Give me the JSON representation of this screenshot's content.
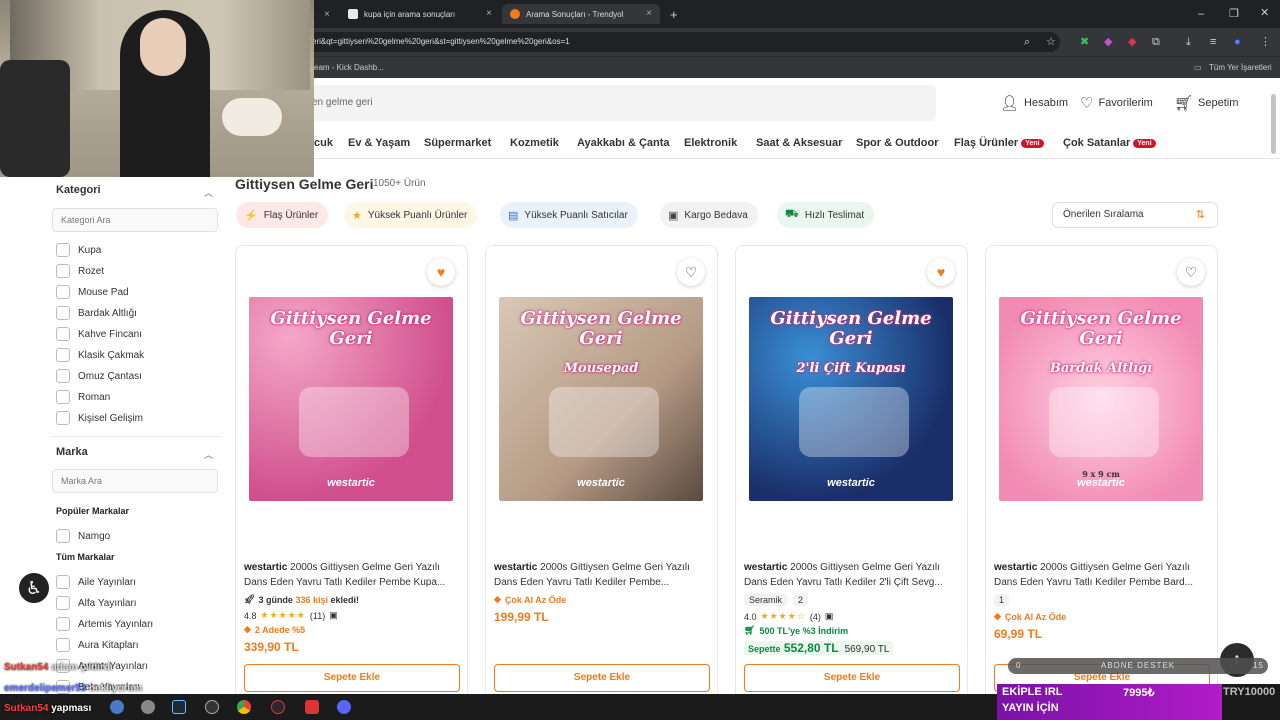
{
  "browser": {
    "tabs": [
      {
        "title": "kupa için arama sonuçları",
        "icon": "kick-icon"
      },
      {
        "title": "Arama Sonuçları - Trendyol",
        "icon": "trendyol-icon"
      }
    ],
    "new_tab": "+",
    "url": "eri&qt=gittiysen%20gelme%20geri&st=gittiysen%20gelme%20geri&os=1",
    "bookmarks": [
      "eam - Kick Dashb...",
      "Tüm Yer İşaretleri"
    ]
  },
  "header": {
    "search_value": "en gelme geri",
    "account": "Hesabım",
    "favorites": "Favorilerim",
    "cart": "Sepetim"
  },
  "nav": {
    "items": [
      "cuk",
      "Ev & Yaşam",
      "Süpermarket",
      "Kozmetik",
      "Ayakkabı & Çanta",
      "Elektronik",
      "Saat & Aksesuar",
      "Spor & Outdoor",
      "Flaş Ürünler",
      "Çok Satanlar"
    ],
    "badge": "Yeni"
  },
  "sidebar": {
    "category_title": "Kategori",
    "category_search": "Kategori Ara",
    "categories": [
      "Kupa",
      "Rozet",
      "Mouse Pad",
      "Bardak Altlığı",
      "Kahve Fincanı",
      "Klasik Çakmak",
      "Omuz Çantası",
      "Roman",
      "Kişisel Gelişim"
    ],
    "brand_title": "Marka",
    "brand_search": "Marka Ara",
    "popular_brands_title": "Popüler Markalar",
    "popular_brands": [
      "Namgo"
    ],
    "all_brands_title": "Tüm Markalar",
    "all_brands": [
      "Aile Yayınları",
      "Alfa Yayınları",
      "Artemis Yayınları",
      "Aura Kitapları",
      "Ayrıntı Yayınları",
      "Beta Yayınları"
    ]
  },
  "results": {
    "title": "Gittiysen Gelme Geri",
    "count": "1050+ Ürün",
    "chips": [
      "Flaş Ürünler",
      "Yüksek Puanlı Ürünler",
      "Yüksek Puanlı Satıcılar",
      "Kargo Bedava",
      "Hızlı Teslimat"
    ],
    "sort": "Önerilen Sıralama"
  },
  "products": [
    {
      "brand": "westartic",
      "name": "2000s Gittiysen Gelme Geri Yazılı Dans Eden Yavru Tatlı Kediler Pembe Kupa...",
      "image_text": "Gittiysen Gelme Geri",
      "image_sub": "",
      "badge_icon": "rocket-icon",
      "badge_pre": "3 günde",
      "badge_num": "336 kişi",
      "badge_post": "ekledi!",
      "rating": "4.8",
      "stars": 4.8,
      "reviews": "(11)",
      "promo": "2 Adede %5",
      "price": "339,90 TL",
      "add": "Sepete Ekle",
      "favorited": true
    },
    {
      "brand": "westartic",
      "name": "2000s Gittiysen Gelme Geri Yazılı Dans Eden Yavru Tatlı Kediler Pembe...",
      "image_text": "Gittiysen Gelme Geri",
      "image_sub": "Mousepad",
      "promo": "Çok Al Az Öde",
      "price": "199,99 TL",
      "add": "Sepete Ekle",
      "favorited": false
    },
    {
      "brand": "westartic",
      "name": "2000s Gittiysen Gelme Geri Yazılı Dans Eden Yavru Tatlı Kediler 2'li Çift Sevg...",
      "image_text": "Gittiysen Gelme Geri",
      "image_sub": "2'li Çift Kupası",
      "tags": [
        "Seramik",
        "2"
      ],
      "rating": "4.0",
      "stars": 4.0,
      "reviews": "(4)",
      "discount": "500 TL'ye %3 İndirim",
      "basket_label": "Sepette",
      "basket_price": "552,80 TL",
      "old_price": "569,90 TL",
      "add": "Sepete Ekle",
      "favorited": true
    },
    {
      "brand": "westartic",
      "name": "2000s Gittiysen Gelme Geri Yazılı Dans Eden Yavru Tatlı Kediler Pembe Bard...",
      "image_text": "Gittiysen Gelme Geri",
      "image_sub": "Bardak Altlığı",
      "image_size": "9 x 9 cm",
      "tags": [
        "1"
      ],
      "promo": "Çok Al Az Öde",
      "price": "69,99 TL",
      "add": "Sepete Ekle",
      "favorited": false
    }
  ],
  "image_brand_mark": "westartic",
  "overlay": {
    "chat": [
      {
        "user": "Sutkan54",
        "msg": "adam çıldırdı",
        "color": "#ff3b3b"
      },
      {
        "user": "emerdelipemer53",
        "msg": "bekliyorum",
        "color": "#5b7cff"
      },
      {
        "user": "Sutkan54",
        "msg": "yapması",
        "color": "#ff3b3b"
      }
    ],
    "sub_goal_left": "0",
    "sub_goal": "ABONE DESTEK",
    "sub_goal_right": "15",
    "promo_line1": "EKİPLE IRL",
    "promo_line2": "YAYIN İÇİN",
    "promo_amount": "7995₺",
    "promo_code": "TRY10000"
  },
  "colors": {
    "accent": "#f27a1a",
    "badge_red": "#d4142b",
    "green": "#0b8a3c"
  }
}
